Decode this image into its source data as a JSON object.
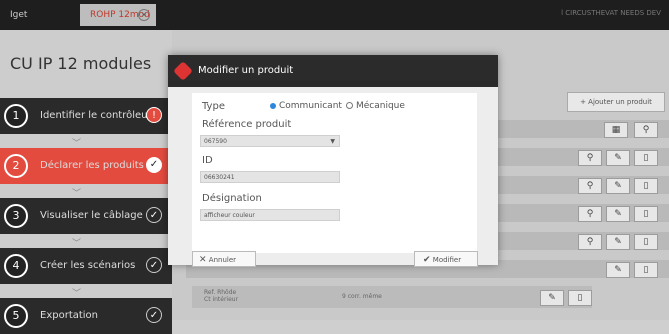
{
  "topbar": {
    "tab_left": "Iget",
    "tab_active": "ROHP 12mod",
    "tab_close": "×",
    "right_text": "l CIRCUSTHEVAT NEEDS DEV"
  },
  "sidebar": {
    "title": "CU IP 12 modules",
    "steps": [
      {
        "num": "1",
        "label": "Identifier le contrôleur",
        "status": "!"
      },
      {
        "num": "2",
        "label": "Déclarer les produits",
        "status": "✓"
      },
      {
        "num": "3",
        "label": "Visualiser le câblage",
        "status": "✓"
      },
      {
        "num": "4",
        "label": "Créer les scénarios",
        "status": "✓"
      },
      {
        "num": "5",
        "label": "Exportation",
        "status": "✓"
      }
    ],
    "chevron": "﹀"
  },
  "background_panel": {
    "add_button": "+ Ajouter un produit",
    "last_row_left": "Ref. Rhôde\nCt intérieur",
    "last_row_mid": "9 corr. même"
  },
  "modal": {
    "title": "Modifier un produit",
    "type_label": "Type",
    "radio_communicant": "Communicant",
    "radio_mecanique": "Mécanique",
    "ref_label": "Référence produit",
    "ref_value": "067590",
    "id_label": "ID",
    "id_value": "06630241",
    "designation_label": "Désignation",
    "designation_value": "afficheur couleur",
    "cancel_label": "Annuler",
    "modify_label": "Modifier"
  },
  "colors": {
    "accent": "#e44b3f",
    "dark": "#2a2a2a"
  }
}
